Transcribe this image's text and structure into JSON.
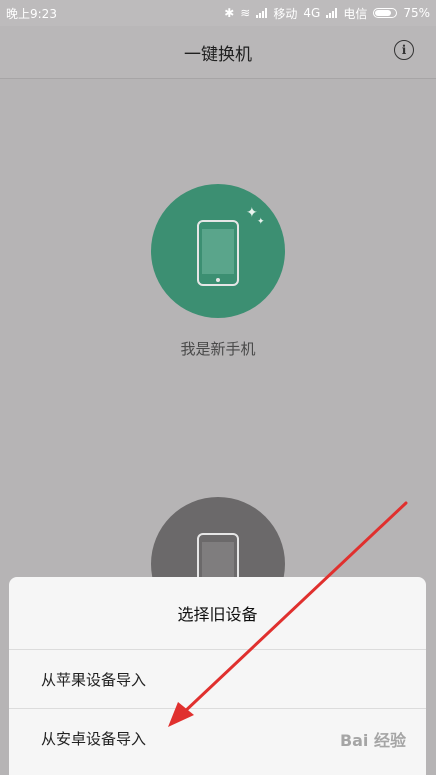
{
  "status": {
    "time": "晚上9:23",
    "carrier1": "移动",
    "network1": "4G",
    "carrier2": "电信",
    "battery": "75%",
    "battery_level": 0.75
  },
  "header": {
    "title": "一键换机",
    "info_icon": "info-icon"
  },
  "main": {
    "new_phone_label": "我是新手机"
  },
  "sheet": {
    "title": "选择旧设备",
    "options": [
      "从苹果设备导入",
      "从安卓设备导入"
    ]
  },
  "watermark": "Bai 经验",
  "colors": {
    "accent": "#3c8f72",
    "arrow": "#e0302e"
  }
}
